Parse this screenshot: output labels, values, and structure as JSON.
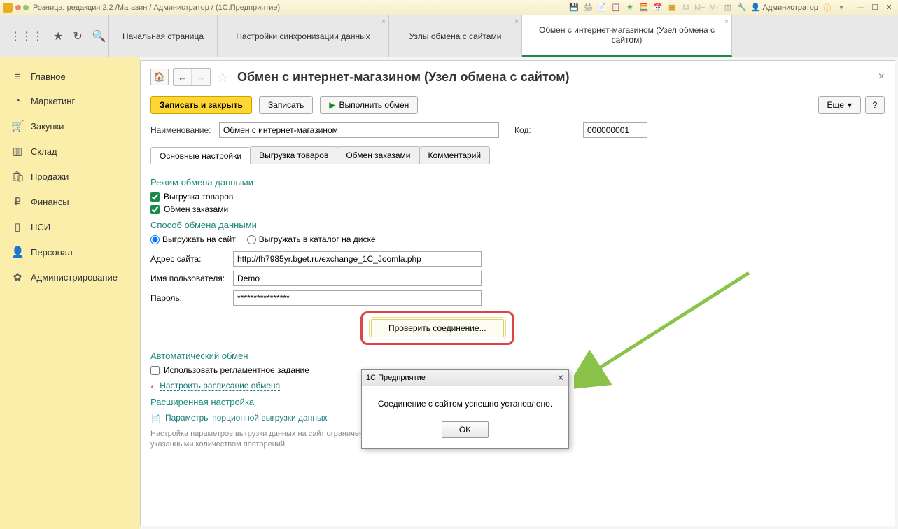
{
  "titlebar": {
    "title": "Розница, редакция 2.2 /Магазин / Администратор / (1С:Предприятие)",
    "user": "Администратор"
  },
  "toptabs": [
    {
      "label": "Начальная страница",
      "closable": false
    },
    {
      "label": "Настройки синхронизации данных",
      "closable": true
    },
    {
      "label": "Узлы обмена с сайтами",
      "closable": true
    },
    {
      "label": "Обмен с интернет-магазином (Узел обмена с сайтом)",
      "closable": true,
      "active": true
    }
  ],
  "sidebar": {
    "items": [
      {
        "icon": "≡",
        "label": "Главное"
      },
      {
        "icon": "◔",
        "label": "Маркетинг"
      },
      {
        "icon": "🛒",
        "label": "Закупки"
      },
      {
        "icon": "▥",
        "label": "Склад"
      },
      {
        "icon": "🛍",
        "label": "Продажи"
      },
      {
        "icon": "₽",
        "label": "Финансы"
      },
      {
        "icon": "▯",
        "label": "НСИ"
      },
      {
        "icon": "👤",
        "label": "Персонал"
      },
      {
        "icon": "✿",
        "label": "Администрирование"
      }
    ]
  },
  "page": {
    "title": "Обмен с интернет-магазином (Узел обмена с сайтом)",
    "buttons": {
      "save_close": "Записать и закрыть",
      "save": "Записать",
      "run": "Выполнить обмен",
      "more": "Еще",
      "help": "?"
    },
    "fields": {
      "name_label": "Наименование:",
      "name_value": "Обмен с интернет-магазином",
      "code_label": "Код:",
      "code_value": "000000001"
    },
    "tabs": [
      "Основные настройки",
      "Выгрузка товаров",
      "Обмен заказами",
      "Комментарий"
    ],
    "active_tab": 0,
    "sections": {
      "mode": "Режим обмена данными",
      "export_goods": "Выгрузка товаров",
      "exchange_orders": "Обмен заказами",
      "method": "Способ обмена данными",
      "r_site": "Выгружать на сайт",
      "r_disk": "Выгружать в каталог на диске",
      "site_addr_label": "Адрес сайта:",
      "site_addr_value": "http://fh7985yr.bget.ru/exchange_1C_Joomla.php",
      "user_label": "Имя пользователя:",
      "user_value": "Demo",
      "pass_label": "Пароль:",
      "pass_value": "****************",
      "check_conn": "Проверить соединение...",
      "auto": "Автоматический обмен",
      "use_reg": "Использовать регламентное задание",
      "schedule": "Настроить расписание обмена",
      "advanced": "Расширенная настройка",
      "chunk_params": "Параметры порционной выгрузки данных",
      "hint": "Настройка параметров выгрузки данных на сайт ограниченными порциями с указанными количеством повторений."
    }
  },
  "dialog": {
    "title": "1С:Предприятие",
    "message": "Соединение с сайтом успешно установлено.",
    "ok": "OK"
  }
}
